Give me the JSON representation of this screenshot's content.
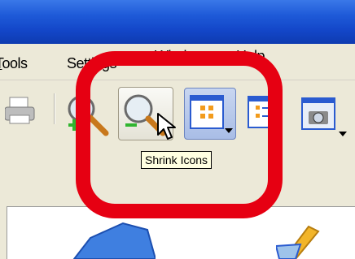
{
  "window": {
    "title_color": "#1e5ad8"
  },
  "menu": {
    "items": [
      {
        "label": "Tools",
        "accel_index": 0
      },
      {
        "label": "Settings",
        "accel_index": 3
      },
      {
        "label": "Window",
        "accel_index": 0
      },
      {
        "label": "Help",
        "accel_index": 0
      }
    ]
  },
  "toolbar": {
    "buttons": [
      {
        "name": "print",
        "icon": "printer-icon"
      },
      {
        "name": "enlarge-icons",
        "icon": "zoom-in-icon"
      },
      {
        "name": "shrink-icons",
        "icon": "zoom-out-icon",
        "state": "hovered"
      },
      {
        "name": "large-icons-view",
        "icon": "large-icons-view-icon",
        "state": "pressed"
      },
      {
        "name": "list-view",
        "icon": "list-view-icon"
      },
      {
        "name": "camera",
        "icon": "camera-icon"
      }
    ],
    "tooltip": "Shrink Icons"
  },
  "highlight": {
    "color": "#e60012"
  }
}
